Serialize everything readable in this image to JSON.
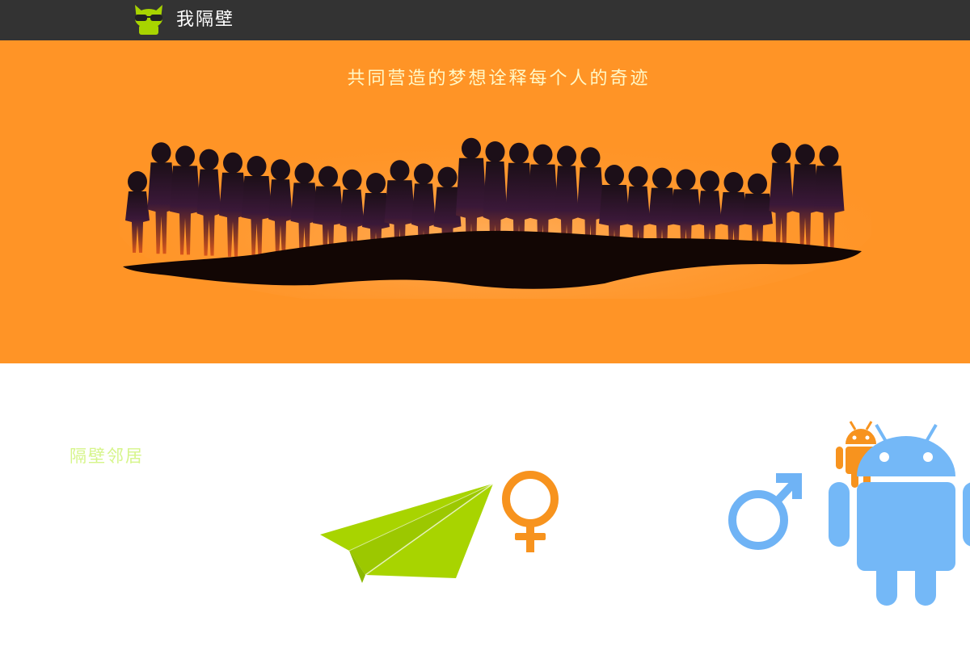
{
  "header": {
    "brand": "我隔壁",
    "logo_icon": "sunglasses-cat-icon"
  },
  "hero": {
    "slogan": "共同营造的梦想诠释每个人的奇迹",
    "image": "crowd-silhouette-illustration"
  },
  "section": {
    "title": "隔壁邻居"
  },
  "icons": [
    "paper-plane-icon",
    "female-symbol-icon",
    "male-symbol-icon",
    "android-icon"
  ],
  "colors": {
    "topbar": "#333333",
    "hero_bg": "#ff9426",
    "slogan": "#fff9c8",
    "section_title": "#d6f58a",
    "plane": "#a8d400",
    "female": "#f7931e",
    "male": "#6fb3f5",
    "android_blue": "#74b8f7",
    "android_orange": "#f7931e"
  }
}
